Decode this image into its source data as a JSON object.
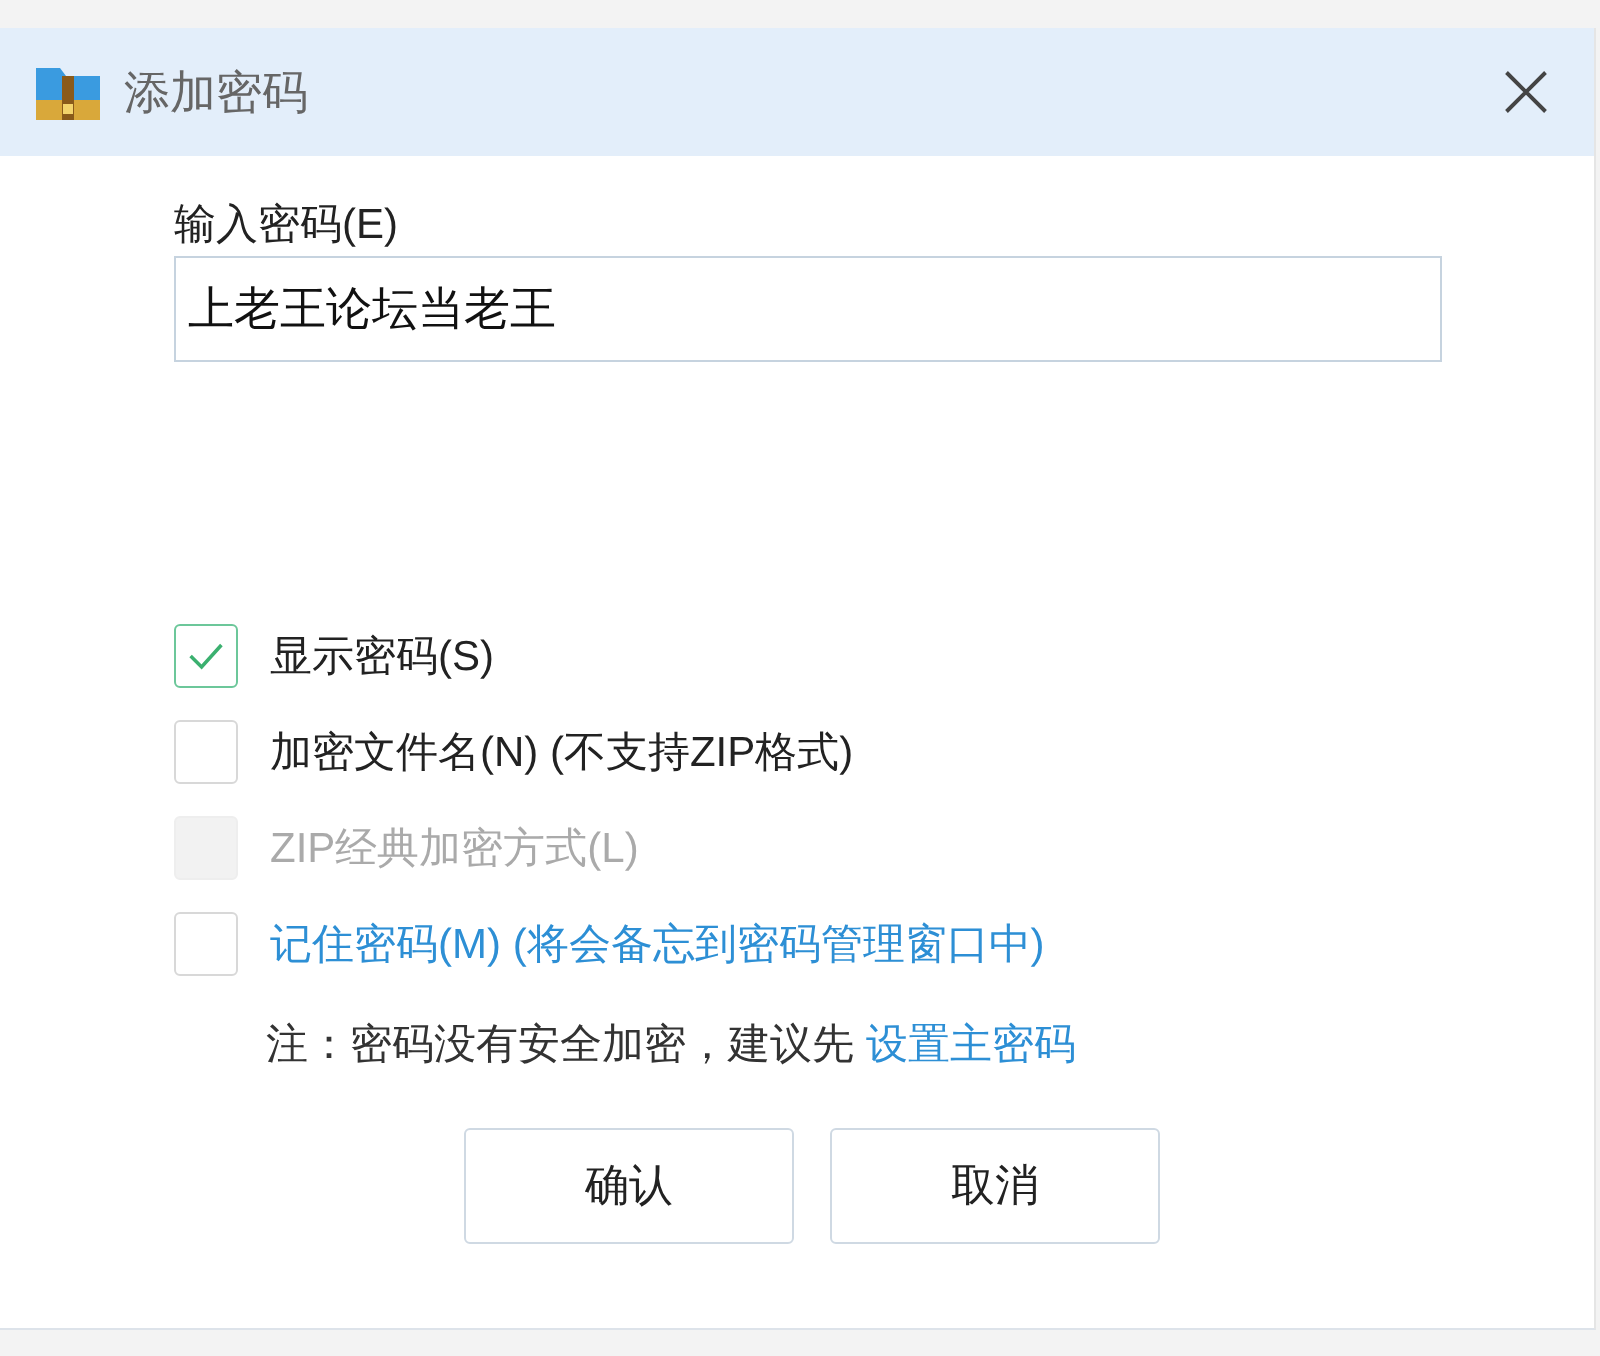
{
  "window": {
    "title": "添加密码"
  },
  "password": {
    "label": "输入密码(E)",
    "value": "上老王论坛当老王"
  },
  "options": [
    {
      "label": "显示密码(S)",
      "kind": "plain",
      "checked": true,
      "disabled": false
    },
    {
      "label": "加密文件名(N) (不支持ZIP格式)",
      "kind": "plain",
      "checked": false,
      "disabled": false
    },
    {
      "label": "ZIP经典加密方式(L)",
      "kind": "plain",
      "checked": false,
      "disabled": true
    },
    {
      "label": "记住密码(M) (将会备忘到密码管理窗口中)",
      "kind": "link",
      "checked": false,
      "disabled": false
    }
  ],
  "note": {
    "text": "注：密码没有安全加密，建议先",
    "link": "设置主密码"
  },
  "buttons": [
    "确认",
    "取消"
  ]
}
